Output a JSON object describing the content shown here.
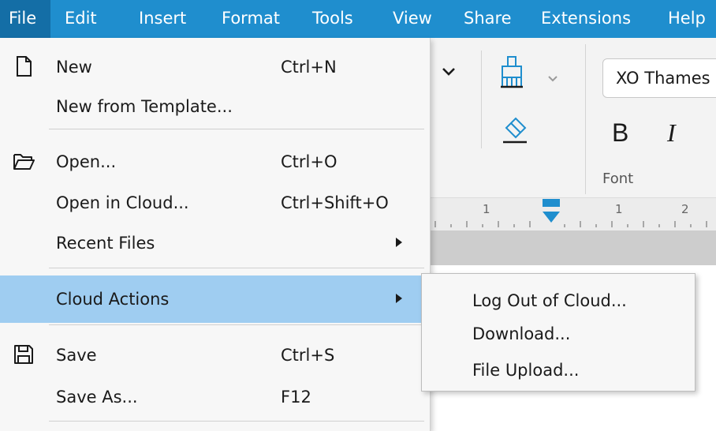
{
  "menubar": {
    "items": [
      "File",
      "Edit",
      "Insert",
      "Format",
      "Tools",
      "View",
      "Share",
      "Extensions",
      "Help"
    ],
    "active": "File"
  },
  "toolbar": {
    "font_name": "XO Thames",
    "bold_label": "B",
    "italic_label": "I",
    "font_group_label": "Font"
  },
  "ruler": {
    "numbers": [
      "1",
      "1",
      "2"
    ]
  },
  "file_menu": {
    "new": {
      "label": "New",
      "shortcut": "Ctrl+N",
      "icon": "new-file-icon"
    },
    "new_from_template": {
      "label": "New from Template..."
    },
    "open": {
      "label": "Open...",
      "shortcut": "Ctrl+O",
      "icon": "open-folder-icon"
    },
    "open_in_cloud": {
      "label": "Open in Cloud...",
      "shortcut": "Ctrl+Shift+O"
    },
    "recent_files": {
      "label": "Recent Files"
    },
    "cloud_actions": {
      "label": "Cloud Actions"
    },
    "save": {
      "label": "Save",
      "shortcut": "Ctrl+S",
      "icon": "save-icon"
    },
    "save_as": {
      "label": "Save As...",
      "shortcut": "F12"
    }
  },
  "cloud_submenu": {
    "items": [
      "Log Out of Cloud...",
      "Download...",
      "File Upload..."
    ]
  },
  "colors": {
    "menubar_bg": "#1f8ece",
    "menubar_active_bg": "#146ea6",
    "highlight_bg": "#9fcdf1",
    "menu_bg": "#f7f7f7"
  }
}
